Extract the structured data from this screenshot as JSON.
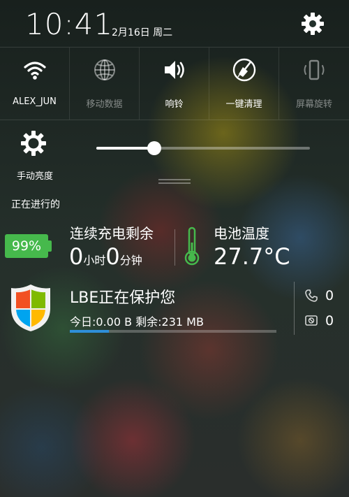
{
  "status": {
    "time": "10:41",
    "date": "2月16日 周二"
  },
  "quick_toggles": [
    {
      "label": "ALEX_JUN",
      "icon": "wifi-icon",
      "active": true
    },
    {
      "label": "移动数据",
      "icon": "globe-icon",
      "active": false
    },
    {
      "label": "响铃",
      "icon": "speaker-icon",
      "active": true
    },
    {
      "label": "一键清理",
      "icon": "broom-icon",
      "active": true
    },
    {
      "label": "屏幕旋转",
      "icon": "rotate-icon",
      "active": false
    }
  ],
  "brightness": {
    "label": "手动亮度",
    "level": 0.27
  },
  "running": {
    "title": "正在进行的"
  },
  "battery": {
    "percent": "99%",
    "charge_title": "连续充电剩余",
    "hours": "0",
    "hours_unit": "小时",
    "minutes": "0",
    "minutes_unit": "分钟",
    "temp_title": "电池温度",
    "temp_value": "27.7°C",
    "color": "#46b94c"
  },
  "protection": {
    "title": "LBE正在保护您",
    "stats": "今日:0.00 B 剩余:231 MB",
    "usage_fraction": 0.19,
    "bar_color": "#2e8fd8",
    "calls_blocked": "0",
    "sms_blocked": "0"
  }
}
